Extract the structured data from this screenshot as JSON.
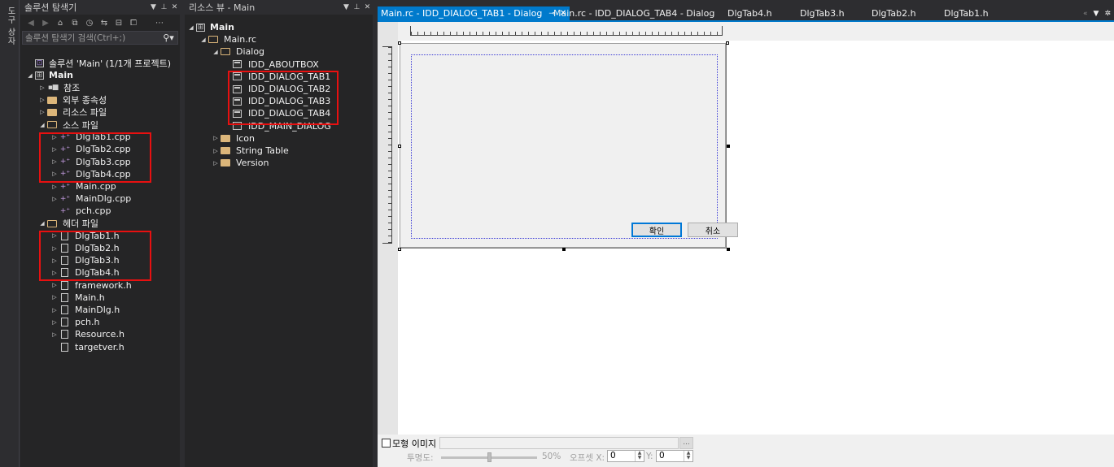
{
  "left_strip": {
    "label": "도구 상자"
  },
  "solution_explorer": {
    "title": "솔루션 탐색기",
    "search_placeholder": "솔루션 탐색기 검색(Ctrl+;)",
    "items": [
      {
        "label": "솔루션 'Main' (1/1개 프로젝트)",
        "icon": "solution-icon",
        "expander": ""
      },
      {
        "label": "Main",
        "icon": "project-icon",
        "expander": "◢",
        "bold": true
      },
      {
        "label": "참조",
        "icon": "references-icon",
        "expander": "▷"
      },
      {
        "label": "외부 종속성",
        "icon": "folder-icon",
        "expander": "▷"
      },
      {
        "label": "리소스 파일",
        "icon": "folder-icon",
        "expander": "▷"
      },
      {
        "label": "소스 파일",
        "icon": "folder-open-icon",
        "expander": "◢"
      },
      {
        "label": "DlgTab1.cpp",
        "icon": "cpp-file-icon",
        "expander": "▷",
        "selected": true
      },
      {
        "label": "DlgTab2.cpp",
        "icon": "cpp-file-icon",
        "expander": "▷"
      },
      {
        "label": "DlgTab3.cpp",
        "icon": "cpp-file-icon",
        "expander": "▷"
      },
      {
        "label": "DlgTab4.cpp",
        "icon": "cpp-file-icon",
        "expander": "▷"
      },
      {
        "label": "Main.cpp",
        "icon": "cpp-file-icon",
        "expander": "▷"
      },
      {
        "label": "MainDlg.cpp",
        "icon": "cpp-file-icon",
        "expander": "▷"
      },
      {
        "label": "pch.cpp",
        "icon": "cpp-file-icon",
        "expander": ""
      },
      {
        "label": "헤더 파일",
        "icon": "folder-open-icon",
        "expander": "◢"
      },
      {
        "label": "DlgTab1.h",
        "icon": "header-file-icon",
        "expander": "▷"
      },
      {
        "label": "DlgTab2.h",
        "icon": "header-file-icon",
        "expander": "▷"
      },
      {
        "label": "DlgTab3.h",
        "icon": "header-file-icon",
        "expander": "▷"
      },
      {
        "label": "DlgTab4.h",
        "icon": "header-file-icon",
        "expander": "▷"
      },
      {
        "label": "framework.h",
        "icon": "header-file-icon",
        "expander": "▷"
      },
      {
        "label": "Main.h",
        "icon": "header-file-icon",
        "expander": "▷"
      },
      {
        "label": "MainDlg.h",
        "icon": "header-file-icon",
        "expander": "▷"
      },
      {
        "label": "pch.h",
        "icon": "header-file-icon",
        "expander": "▷"
      },
      {
        "label": "Resource.h",
        "icon": "header-file-icon",
        "expander": "▷"
      },
      {
        "label": "targetver.h",
        "icon": "header-file-icon",
        "expander": ""
      }
    ]
  },
  "resource_view": {
    "title": "리소스 뷰 - Main",
    "items": [
      {
        "label": "Main",
        "icon": "project-icon",
        "expander": "◢",
        "bold": true
      },
      {
        "label": "Main.rc",
        "icon": "folder-open-icon",
        "expander": "◢"
      },
      {
        "label": "Dialog",
        "icon": "folder-open-icon",
        "expander": "◢"
      },
      {
        "label": "IDD_ABOUTBOX",
        "icon": "dialog-resource-icon",
        "expander": ""
      },
      {
        "label": "IDD_DIALOG_TAB1",
        "icon": "dialog-resource-icon",
        "expander": "",
        "selected": true
      },
      {
        "label": "IDD_DIALOG_TAB2",
        "icon": "dialog-resource-icon",
        "expander": ""
      },
      {
        "label": "IDD_DIALOG_TAB3",
        "icon": "dialog-resource-icon",
        "expander": ""
      },
      {
        "label": "IDD_DIALOG_TAB4",
        "icon": "dialog-resource-icon",
        "expander": ""
      },
      {
        "label": "IDD_MAIN_DIALOG",
        "icon": "dialog-resource-icon",
        "expander": ""
      },
      {
        "label": "Icon",
        "icon": "folder-icon",
        "expander": "▷"
      },
      {
        "label": "String Table",
        "icon": "folder-icon",
        "expander": "▷"
      },
      {
        "label": "Version",
        "icon": "folder-icon",
        "expander": "▷"
      }
    ]
  },
  "tabs": [
    {
      "label": "Main.rc - IDD_DIALOG_TAB1 - Dialog",
      "active": true
    },
    {
      "label": "Main.rc - IDD_DIALOG_TAB4 - Dialog"
    },
    {
      "label": "DlgTab4.h"
    },
    {
      "label": "DlgTab3.h"
    },
    {
      "label": "DlgTab2.h"
    },
    {
      "label": "DlgTab1.h"
    }
  ],
  "dialog": {
    "ok_label": "확인",
    "cancel_label": "취소"
  },
  "bottom_bar": {
    "mockup_label": "모형 이미지",
    "opacity_label": "투명도:",
    "opacity_value": "50%",
    "offset_label": "오프셋 X:",
    "offset_x": "0",
    "y_label": "Y:",
    "offset_y": "0",
    "browse_label": "..."
  },
  "colors": {
    "accent": "#007acc",
    "highlight": "#e81010",
    "panel_bg": "#252526"
  }
}
